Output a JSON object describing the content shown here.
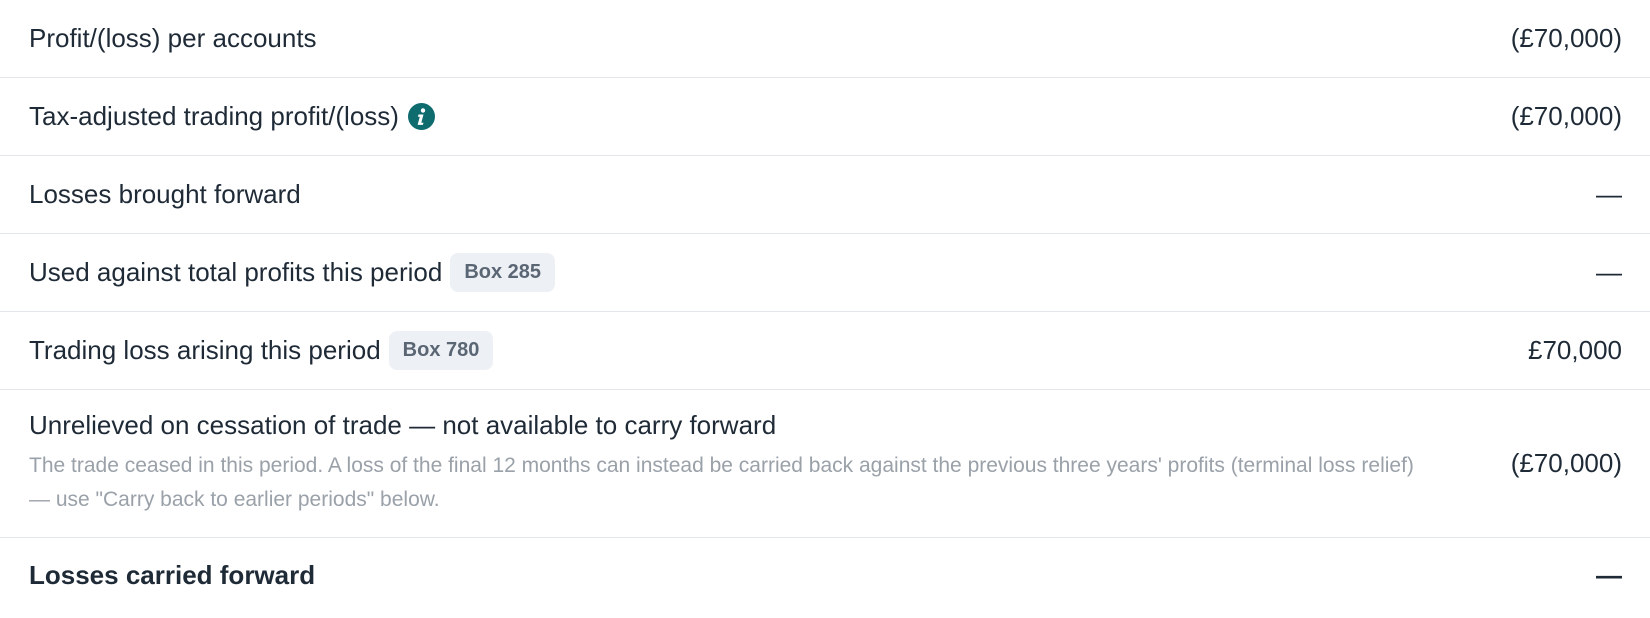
{
  "rows": [
    {
      "label": "Profit/(loss) per accounts",
      "value": "(£70,000)"
    },
    {
      "label": "Tax-adjusted trading profit/(loss)",
      "value": "(£70,000)",
      "icon": "info-icon"
    },
    {
      "label": "Losses brought forward",
      "value": "—"
    },
    {
      "label": "Used against total profits this period",
      "badge": "Box 285",
      "value": "—"
    },
    {
      "label": "Trading loss arising this period",
      "badge": "Box 780",
      "value": "£70,000"
    },
    {
      "label": "Unrelieved on cessation of trade — not available to carry forward",
      "description": "The trade ceased in this period. A loss of the final 12 months can instead be carried back against the previous three years' profits (terminal loss relief) — use \"Carry back to earlier periods\" below.",
      "value": "(£70,000)"
    },
    {
      "label": "Losses carried forward",
      "value": "—"
    }
  ],
  "colors": {
    "accent": "#0e6b6e",
    "text": "#1f2a37",
    "muted": "#9aa1a9",
    "badge_bg": "#edf0f4"
  }
}
